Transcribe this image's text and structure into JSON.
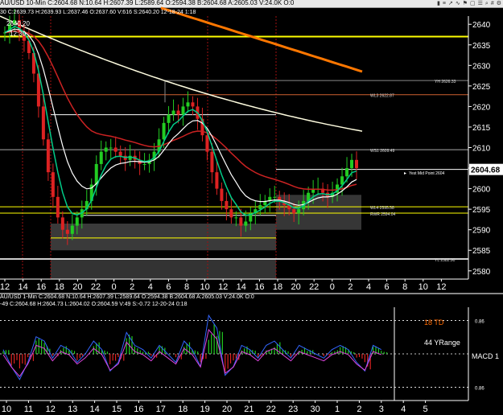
{
  "top_chart_header": {
    "title": "AU/USD 10-Min C:2604.68 N:10.64 H:2607.39 L:2589.64 O:2594.38 B:2604.68 A:2605.03 V:24.0K O:0",
    "subtitle": "30 C:2639.73 H:2639.93 L:2637.46 O:2637.60 V:616 S:2640.20 12-18-24 1:18",
    "icons": [
      "chart-icon",
      "bars-icon",
      "arrow-icon",
      "wave-icon",
      "flag-icon",
      "box-icon",
      "lines-icon",
      "zoom-icon",
      "grid-icon",
      "settings-icon"
    ]
  },
  "bottom_chart_header": {
    "title": "AU/USD 1-Min C:2604.68 N:10.64 H:2607.39 L:2589.64 O:2594.38 B:2604.68 A:2605.03 V:24.0K O:0",
    "subtitle": "-49 C:2604.68 H:2604.73 L:2604.02 O:2604.59 V:49 S:-0.72 12-20-24 0:18"
  },
  "chart_data": [
    {
      "type": "line",
      "name": "price-chart",
      "ylim": [
        2578,
        2642
      ],
      "y_ticks": [
        2580,
        2585,
        2590,
        2595,
        2600,
        2605,
        2610,
        2615,
        2620,
        2625,
        2630,
        2635,
        2640
      ],
      "x_tick_labels": [
        "12",
        "14",
        "16",
        "18",
        "20",
        "22",
        "0",
        "2",
        "4",
        "6",
        "8",
        "10",
        "12",
        "14",
        "16",
        "18",
        "20",
        "22",
        "0",
        "2",
        "4",
        "6",
        "8",
        "10",
        "12"
      ],
      "last_price_label": "2604.68",
      "colors": {
        "candle_up": "#22cc22",
        "candle_down": "#dd2222",
        "ema_fast": "#00cc88",
        "ema_mid": "#ffffff",
        "ema_slow": "#cc2222",
        "ma_long": "#fffde0",
        "ma_very_long": "#ff7700",
        "level": "#ffff00"
      },
      "annotations": [
        {
          "text": "2640.20",
          "price": 2640.2
        },
        {
          "text": "12:30",
          "price": 2637.8
        },
        {
          "text": "YH 2626.33",
          "price": 2626.33
        },
        {
          "text": "WL3 2622.87",
          "price": 2622.87
        },
        {
          "text": "WS1 2609.49",
          "price": 2609.49
        },
        {
          "text": "Yest Mid Point 2604",
          "price": 2604
        },
        {
          "text": "WL4 2595.58",
          "price": 2595.58
        },
        {
          "text": "RWR 2594.04",
          "price": 2594.04
        },
        {
          "text": "YL 2582.90",
          "price": 2582.9
        }
      ],
      "levels": [
        {
          "price": 2637.0,
          "color": "#ffff00",
          "width": 2
        },
        {
          "price": 2626.33,
          "color": "#888888",
          "width": 1
        },
        {
          "price": 2622.87,
          "color": "#d06030",
          "width": 1
        },
        {
          "price": 2609.49,
          "color": "#aaaaaa",
          "width": 1
        },
        {
          "price": 2604.68,
          "color": "#ffffff",
          "width": 1
        },
        {
          "price": 2595.58,
          "color": "#ffff00",
          "width": 1
        },
        {
          "price": 2594.04,
          "color": "#ffff00",
          "width": 1
        },
        {
          "price": 2588.0,
          "color": "#ffff00",
          "width": 1
        },
        {
          "price": 2582.9,
          "color": "#cccccc",
          "width": 2
        }
      ],
      "series_close": [
        2638,
        2640,
        2641,
        2638,
        2636,
        2633,
        2628,
        2620,
        2612,
        2604,
        2598,
        2593,
        2590,
        2589,
        2591,
        2593,
        2595,
        2597,
        2601,
        2606,
        2609,
        2610,
        2610,
        2609,
        2608,
        2607,
        2608,
        2607,
        2606,
        2606,
        2607,
        2609,
        2612,
        2616,
        2618,
        2619,
        2618,
        2620,
        2621,
        2620,
        2617,
        2613,
        2609,
        2604,
        2600,
        2597,
        2595,
        2593,
        2593,
        2591,
        2592,
        2594,
        2595,
        2596,
        2597,
        2598,
        2598,
        2597,
        2596,
        2595,
        2594,
        2595,
        2597,
        2599,
        2600,
        2600,
        2599,
        2598,
        2599,
        2601,
        2603,
        2605,
        2607,
        2605
      ]
    },
    {
      "type": "line",
      "name": "oscillator-chart",
      "ylim": [
        -1.2,
        1.2
      ],
      "x_tick_labels": [
        "10",
        "11",
        "12",
        "13",
        "14",
        "15",
        "16",
        "17",
        "18",
        "19",
        "20",
        "21",
        "22",
        "23",
        "30",
        "1",
        "2",
        "3",
        "4",
        "5"
      ],
      "y_tick_labels": [
        "0.86",
        "0.86"
      ],
      "labels": [
        {
          "text": "18 TD",
          "color": "#ff6a00"
        },
        {
          "text": "44 YRange",
          "color": "#ffffff"
        },
        {
          "text": "MACD 1",
          "color": "#ffffff"
        }
      ],
      "series_macd": [
        0.1,
        -0.3,
        -0.6,
        -0.2,
        0.4,
        0.3,
        -0.1,
        0.2,
        0.1,
        -0.2,
        0.0,
        0.3,
        0.1,
        -0.4,
        -0.2,
        0.5,
        0.2,
        0.1,
        -0.1,
        0.2,
        0.0,
        -0.2,
        0.3,
        0.1,
        -0.3,
        0.9,
        0.6,
        -0.5,
        -0.3,
        0.2,
        0.1,
        -0.1,
        0.2,
        0.3,
        0.1,
        -0.1,
        0.2,
        0.1,
        0.0,
        -0.1,
        0.1,
        0.2,
        0.1,
        -0.2,
        -0.4,
        0.2,
        0.1
      ]
    }
  ]
}
